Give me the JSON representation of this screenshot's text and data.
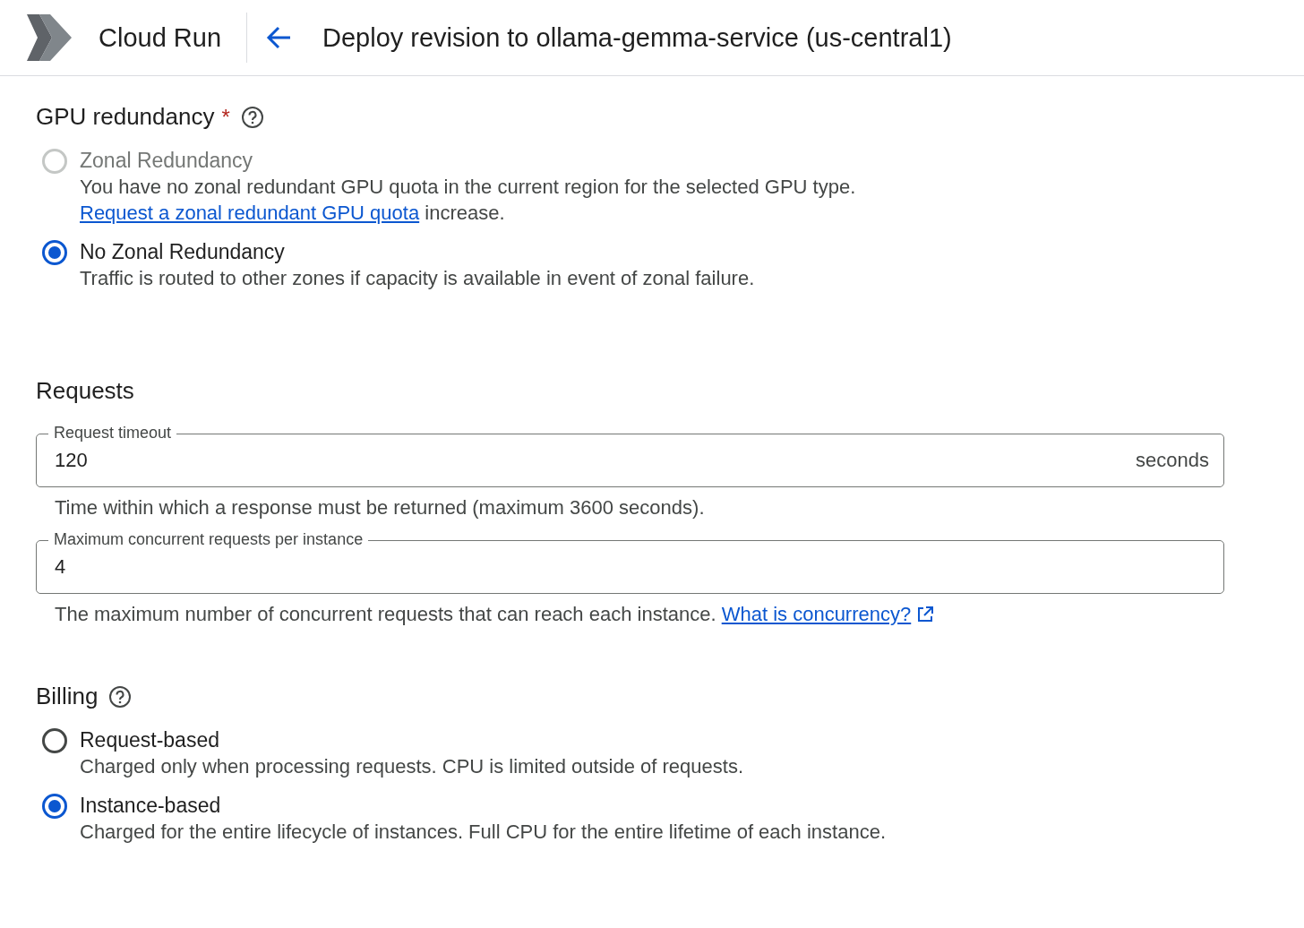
{
  "header": {
    "product": "Cloud Run",
    "title": "Deploy revision to ollama-gemma-service (us-central1)"
  },
  "gpu_redundancy": {
    "title": "GPU redundancy",
    "required_mark": "*",
    "options": [
      {
        "label": "Zonal Redundancy",
        "selected": false,
        "disabled": true,
        "description": "You have no zonal redundant GPU quota in the current region for the selected GPU type. ",
        "link": "Request a zonal redundant GPU quota",
        "suffix": " increase."
      },
      {
        "label": "No Zonal Redundancy",
        "selected": true,
        "disabled": false,
        "description": "Traffic is routed to other zones if capacity is available in event of zonal failure."
      }
    ]
  },
  "requests": {
    "title": "Requests",
    "fields": [
      {
        "label": "Request timeout",
        "value": "120",
        "unit": "seconds",
        "helper": "Time within which a response must be returned (maximum 3600 seconds)."
      },
      {
        "label": "Maximum concurrent requests per instance",
        "value": "4",
        "helper": "The maximum number of concurrent requests that can reach each instance. ",
        "helper_link": "What is concurrency?"
      }
    ]
  },
  "billing": {
    "title": "Billing",
    "options": [
      {
        "label": "Request-based",
        "selected": false,
        "disabled": false,
        "description": "Charged only when processing requests. CPU is limited outside of requests."
      },
      {
        "label": "Instance-based",
        "selected": true,
        "disabled": false,
        "description": "Charged for the entire lifecycle of instances. Full CPU for the entire lifetime of each instance."
      }
    ]
  }
}
